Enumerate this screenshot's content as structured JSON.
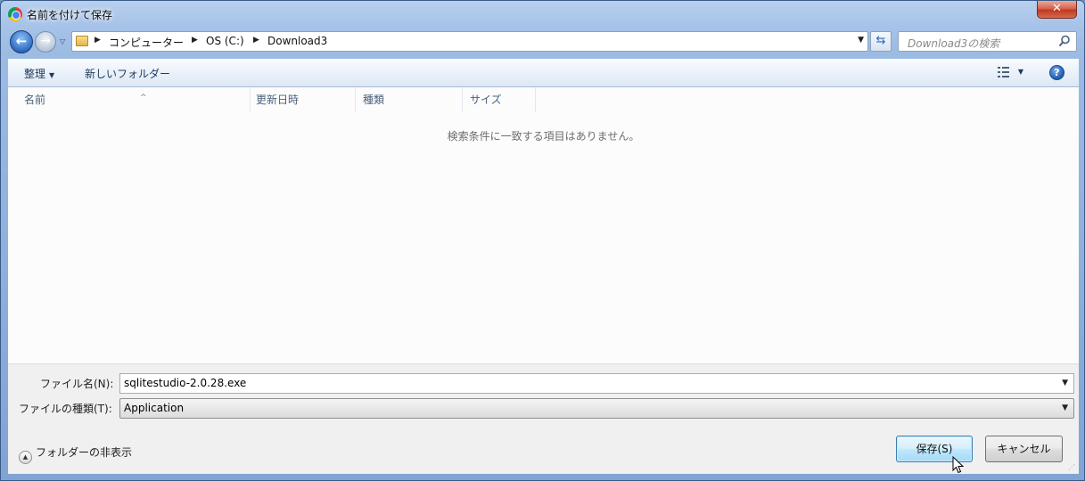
{
  "window": {
    "title": "名前を付けて保存",
    "close_label": "✕"
  },
  "address": {
    "crumbs": [
      "コンピューター",
      "OS (C:)",
      "Download3"
    ],
    "search_placeholder": "Download3の検索"
  },
  "toolbar": {
    "organize_label": "整理",
    "new_folder_label": "新しいフォルダー",
    "help_label": "?"
  },
  "file_list": {
    "columns": [
      "名前",
      "更新日時",
      "種類",
      "サイズ"
    ],
    "empty_message": "検索条件に一致する項目はありません。"
  },
  "form": {
    "filename_label": "ファイル名(N):",
    "filename_value": "sqlitestudio-2.0.28.exe",
    "filetype_label": "ファイルの種類(T):",
    "filetype_value": "Application"
  },
  "footer": {
    "hide_folders_label": "フォルダーの非表示",
    "save_label": "保存(S)",
    "cancel_label": "キャンセル"
  }
}
